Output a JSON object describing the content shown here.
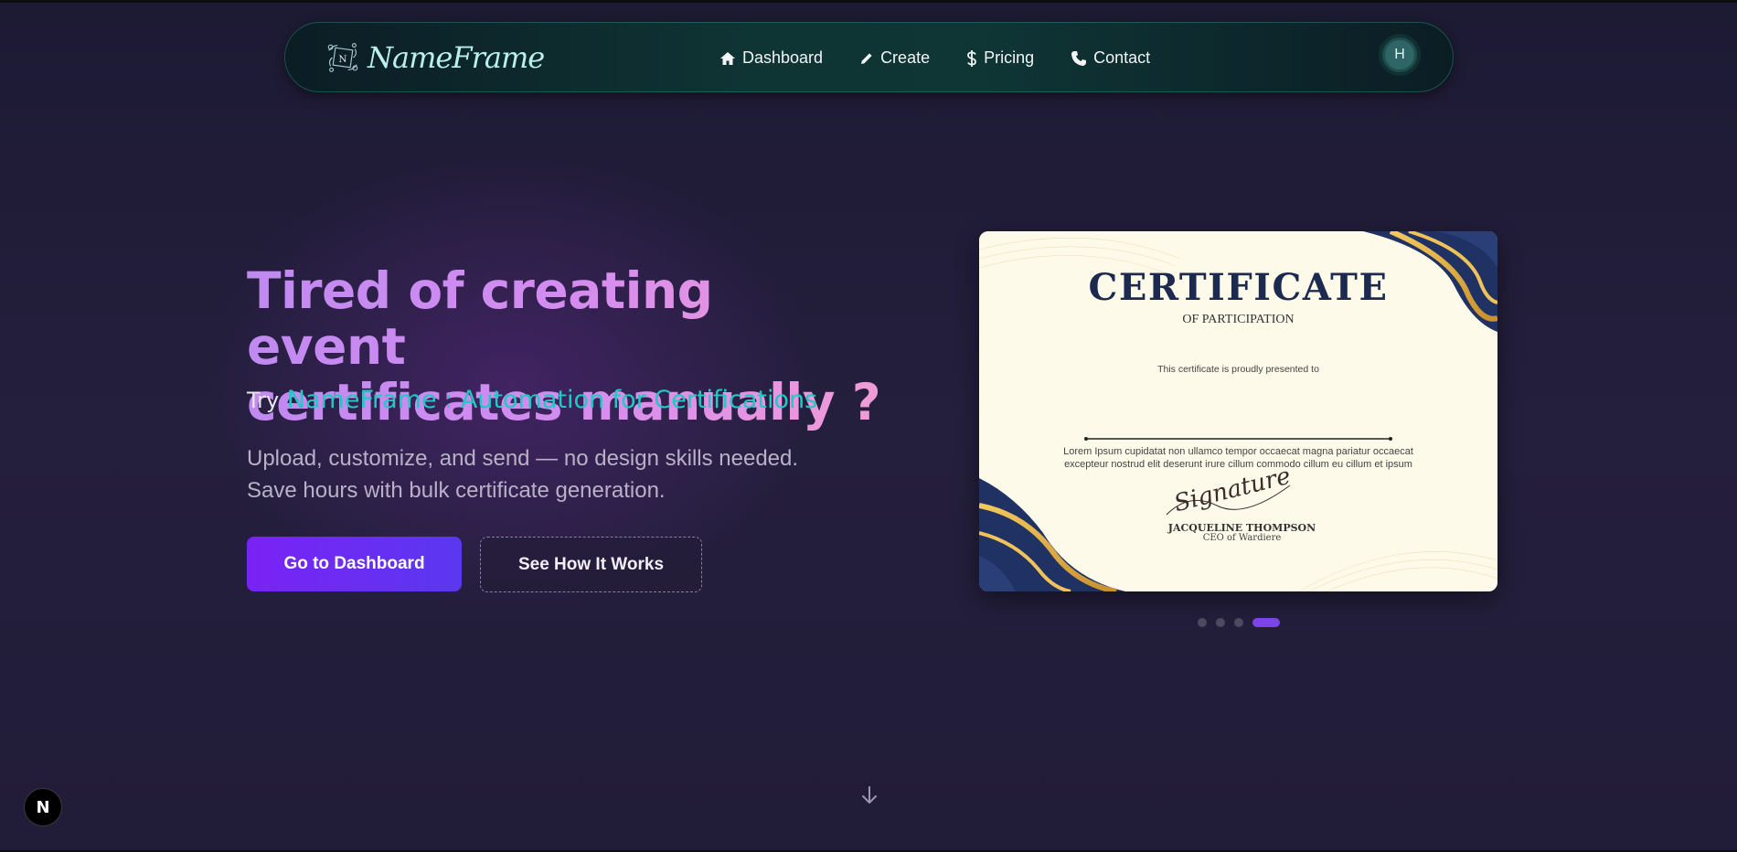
{
  "navbar": {
    "brand": "NameFrame",
    "emblem_letter": "N",
    "links": [
      {
        "label": "Dashboard",
        "icon": "home-icon"
      },
      {
        "label": "Create",
        "icon": "pencil-icon"
      },
      {
        "label": "Pricing",
        "icon": "dollar-icon"
      },
      {
        "label": "Contact",
        "icon": "phone-icon"
      }
    ],
    "avatar_initial": "H"
  },
  "hero": {
    "headline_line1": "Tired of creating event",
    "headline_line2": "certificates manually ?",
    "tagline_prefix": "Try",
    "tagline_brand": "NameFrame : Automation for Certifications",
    "subtext_line1": "Upload, customize, and send — no design skills needed.",
    "subtext_line2": "Save hours with bulk certificate generation.",
    "primary_button": "Go to Dashboard",
    "secondary_button": "See How It Works"
  },
  "certificate": {
    "title": "CERTIFICATE",
    "subtitle": "OF PARTICIPATION",
    "presented": "This certificate is proudly presented to",
    "body_line1": "Lorem Ipsum cupidatat non ullamco tempor occaecat magna pariatur occaecat",
    "body_line2": "excepteur nostrud elit deserunt irure cillum commodo cillum eu cillum et ipsum",
    "signature": "Signature",
    "signer": "JACQUELINE THOMPSON",
    "role": "CEO of Wardiere"
  },
  "carousel": {
    "slides": 4,
    "active_index": 3
  },
  "badge": {
    "label": "N"
  },
  "colors": {
    "accent_purple": "#7a22f5",
    "brand_teal": "#22c8c4",
    "headline_gradient_start": "#c08af1",
    "headline_gradient_end": "#f29bd7",
    "nav_teal": "#0f3434"
  }
}
